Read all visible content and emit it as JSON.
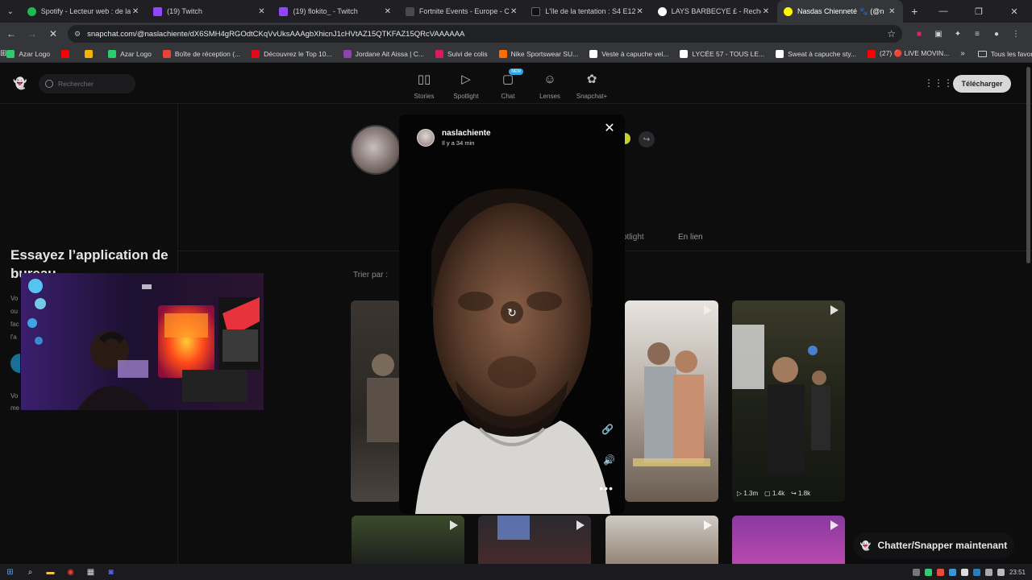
{
  "browser": {
    "tabs": [
      {
        "title": "Spotify - Lecteur web : de la mu",
        "favicon_color": "#1db954",
        "active": false
      },
      {
        "title": "(19) Twitch",
        "favicon_color": "#9146ff",
        "active": false
      },
      {
        "title": "(19) flokito_ - Twitch",
        "favicon_color": "#9146ff",
        "active": false
      },
      {
        "title": "Fortnite Events - Europe - Com",
        "favicon_color": "#3a3a3a",
        "active": false
      },
      {
        "title": "L'île de la tentation : S4 E12 (2/",
        "favicon_color": "#111111",
        "active": false
      },
      {
        "title": "LAYS BARBECYE £ - Recherche",
        "favicon_color": "#ffffff",
        "active": false
      },
      {
        "title": "Nasdas Chienneté 🐾 (@n",
        "favicon_color": "#fffc00",
        "active": true
      }
    ],
    "url": "snapchat.com/@naslachiente/dX6SMH4gRGOdtCKqVvUksAAAgbXhicnJ1cHVtAZ15QTKFAZ15QRcVAAAAAA",
    "bookmarks": [
      {
        "label": "Azar Logo",
        "color": "#2ecc71"
      },
      {
        "label": "",
        "color": "#ff0000"
      },
      {
        "label": "",
        "color": "#f4b400"
      },
      {
        "label": "Azar Logo",
        "color": "#2ecc71"
      },
      {
        "label": "Boîte de réception (...",
        "color": "#ea4335"
      },
      {
        "label": "Découvrez le Top 10...",
        "color": "#e50914"
      },
      {
        "label": "Jordane Ait Aissa | C...",
        "color": "#8e44ad"
      },
      {
        "label": "Suivi de colis",
        "color": "#d81b60"
      },
      {
        "label": "Nike Sportswear SU...",
        "color": "#ff6d00"
      },
      {
        "label": "Veste à capuche vel...",
        "color": "#ffffff"
      },
      {
        "label": "LYCÉE 57 - TOUS LE...",
        "color": "#ffffff"
      },
      {
        "label": "Sweat à capuche sty...",
        "color": "#ffffff"
      },
      {
        "label": "(27) 🔴 LIVE MOVIN...",
        "color": "#ff0000"
      }
    ],
    "all_bookmarks": "Tous les favoris"
  },
  "snapchat": {
    "search_placeholder": "Rechercher",
    "nav": [
      {
        "label": "Stories",
        "icon": "stories-icon",
        "glyph": "▯▯"
      },
      {
        "label": "Spotlight",
        "icon": "spotlight-icon",
        "glyph": "▷"
      },
      {
        "label": "Chat",
        "icon": "chat-icon",
        "glyph": "▢",
        "badge": "NEW"
      },
      {
        "label": "Lenses",
        "icon": "lenses-icon",
        "glyph": "☺"
      },
      {
        "label": "Snapchat+",
        "icon": "snapchat-plus-icon",
        "glyph": "✿"
      }
    ],
    "download_label": "Télécharger",
    "promo": {
      "title": "Essayez l’application de bureau",
      "lines": [
        "Vo",
        "ou",
        "fac",
        "l'a"
      ],
      "foot": [
        "Vo",
        "me"
      ]
    },
    "profile_tabs": {
      "spotlight": "otlight",
      "linked": "En lien"
    },
    "sort_label": "Trier par :",
    "grid_stats": {
      "views": "1.3m",
      "comments": "1.4k",
      "shares": "1.8k"
    },
    "chat_now": "Chatter/Snapper maintenant"
  },
  "story": {
    "username": "naslachiente",
    "time_ago": "Il y a 34 min"
  },
  "taskbar": {
    "clock": "23:51"
  }
}
